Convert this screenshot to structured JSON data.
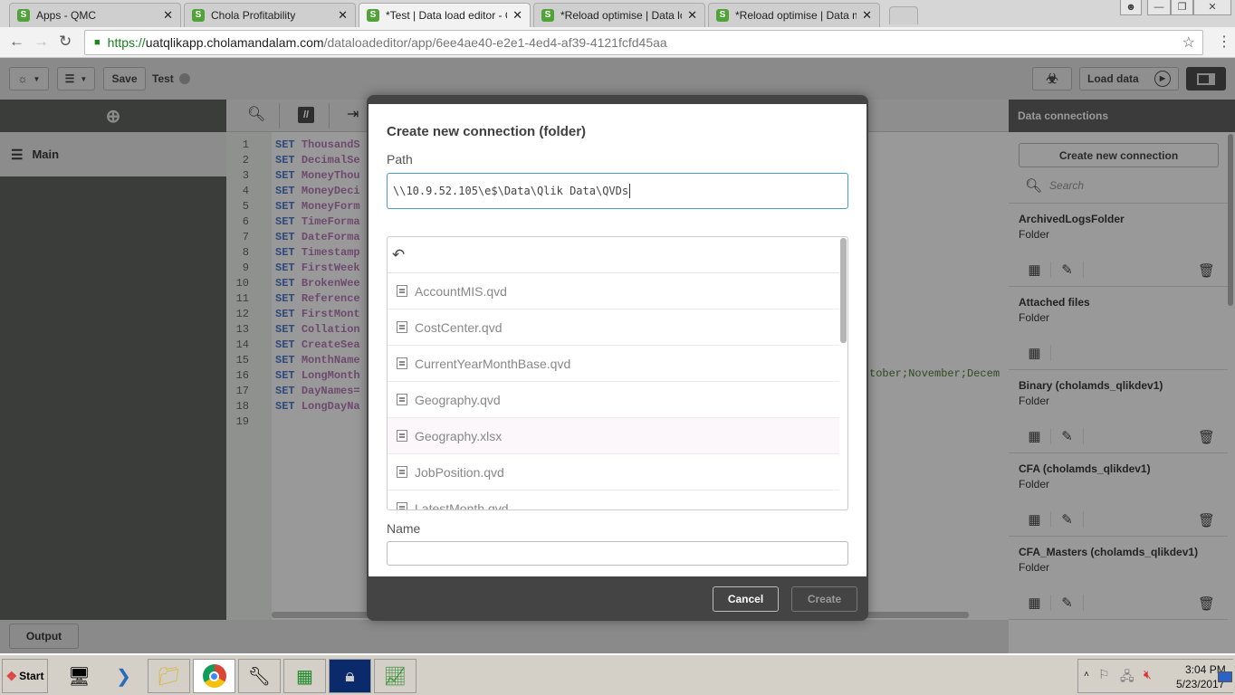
{
  "browser": {
    "tabs": [
      {
        "title": "Apps - QMC",
        "active": false
      },
      {
        "title": "Chola Profitability",
        "active": false
      },
      {
        "title": "*Test | Data load editor - Q",
        "active": true
      },
      {
        "title": "*Reload optimise | Data loa",
        "active": false
      },
      {
        "title": "*Reload optimise | Data mo",
        "active": false
      }
    ],
    "url_scheme": "https://",
    "url_host": "uatqlikapp.cholamandalam.com",
    "url_path": "/dataloadeditor/app/6ee4ae40-e2e1-4ed4-af39-4121fcfd45aa"
  },
  "toolbar": {
    "save_label": "Save",
    "app_name": "Test",
    "load_data_label": "Load data"
  },
  "left_panel": {
    "section": "Main"
  },
  "editor": {
    "lines": [
      {
        "n": "1",
        "kw": "SET",
        "v": "ThousandS"
      },
      {
        "n": "2",
        "kw": "SET",
        "v": "DecimalSe"
      },
      {
        "n": "3",
        "kw": "SET",
        "v": "MoneyThou"
      },
      {
        "n": "4",
        "kw": "SET",
        "v": "MoneyDeci"
      },
      {
        "n": "5",
        "kw": "SET",
        "v": "MoneyForm"
      },
      {
        "n": "6",
        "kw": "SET",
        "v": "TimeForma"
      },
      {
        "n": "7",
        "kw": "SET",
        "v": "DateForma"
      },
      {
        "n": "8",
        "kw": "SET",
        "v": "Timestamp"
      },
      {
        "n": "9",
        "kw": "SET",
        "v": "FirstWeek"
      },
      {
        "n": "10",
        "kw": "SET",
        "v": "BrokenWee"
      },
      {
        "n": "11",
        "kw": "SET",
        "v": "Reference"
      },
      {
        "n": "12",
        "kw": "SET",
        "v": "FirstMont"
      },
      {
        "n": "13",
        "kw": "SET",
        "v": "Collation"
      },
      {
        "n": "14",
        "kw": "SET",
        "v": "CreateSea"
      },
      {
        "n": "15",
        "kw": "SET",
        "v": "MonthName"
      },
      {
        "n": "16",
        "kw": "SET",
        "v": "LongMonth"
      },
      {
        "n": "17",
        "kw": "SET",
        "v": "DayNames="
      },
      {
        "n": "18",
        "kw": "SET",
        "v": "LongDayNa"
      },
      {
        "n": "19",
        "kw": "",
        "v": ""
      }
    ],
    "line16_tail": "tober;November;Decem"
  },
  "output_label": "Output",
  "data_connections": {
    "title": "Data connections",
    "create_label": "Create new connection",
    "search_placeholder": "Search",
    "items": [
      {
        "name": "ArchivedLogsFolder",
        "type": "Folder",
        "editable": true
      },
      {
        "name": "Attached files",
        "type": "Folder",
        "editable": false
      },
      {
        "name": "Binary (cholamds_qlikdev1)",
        "type": "Folder",
        "editable": true
      },
      {
        "name": "CFA (cholamds_qlikdev1)",
        "type": "Folder",
        "editable": true
      },
      {
        "name": "CFA_Masters (cholamds_qlikdev1)",
        "type": "Folder",
        "editable": true
      }
    ]
  },
  "dialog": {
    "title": "Create new connection (folder)",
    "path_label": "Path",
    "path_value": "\\\\10.9.52.105\\e$\\Data\\Qlik Data\\QVDs",
    "files": [
      "AccountMIS.qvd",
      "CostCenter.qvd",
      "CurrentYearMonthBase.qvd",
      "Geography.qvd",
      "Geography.xlsx",
      "JobPosition.qvd",
      "LatestMonth.qvd"
    ],
    "name_label": "Name",
    "name_value": "",
    "cancel_label": "Cancel",
    "create_label": "Create"
  },
  "taskbar": {
    "start_label": "Start",
    "time": "3:04 PM",
    "date": "5/23/2017"
  },
  "colors": {
    "qlik_green": "#52a23a",
    "focus_blue": "#4a9bd0",
    "dialog_footer": "#444444"
  }
}
